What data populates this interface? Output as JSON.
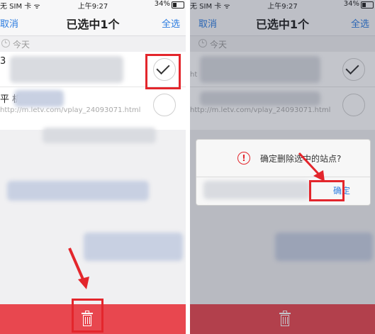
{
  "status_bar": {
    "carrier": "无 SIM 卡 ᯤ",
    "time": "上午9:27",
    "battery": "34%"
  },
  "nav": {
    "cancel": "取消",
    "title": "已选中1个",
    "select_all": "全选"
  },
  "section": {
    "label": "今天"
  },
  "left_list": [
    {
      "title": "3",
      "url": ""
    },
    {
      "title": "平  机乐视网",
      "url": "http://m.letv.com/vplay_24093071.html"
    }
  ],
  "right_list": [
    {
      "title": "",
      "url": "ht"
    },
    {
      "title": "",
      "url": "http://m.letv.com/vplay_24093071.html"
    }
  ],
  "dialog": {
    "message": "确定删除选中的站点?",
    "confirm": "确定"
  },
  "icons": {
    "time": "clock-icon",
    "selected": "checkmark-icon",
    "delete": "trash-icon",
    "warning": "alert-icon"
  },
  "colors": {
    "accent": "#2c7ce0",
    "delete_bar": "#e8474f",
    "highlight": "#e3262c"
  }
}
